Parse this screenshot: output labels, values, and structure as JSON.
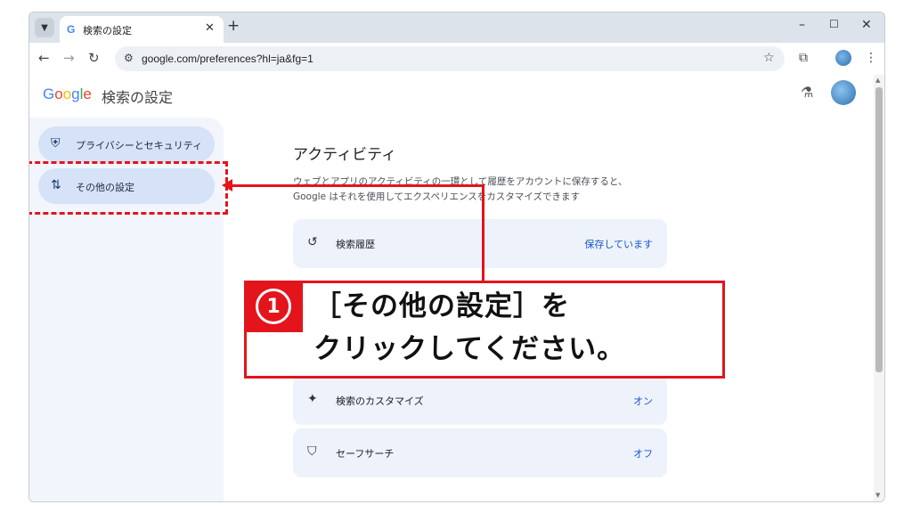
{
  "browser": {
    "tab_title": "検索の設定",
    "tab_favicon": "G",
    "close_tab": "✕",
    "new_tab": "+",
    "url": "google.com/preferences?hl=ja&fg=1",
    "window_minimize": "–",
    "window_maximize": "☐",
    "window_close": "✕"
  },
  "header": {
    "logo": [
      "G",
      "o",
      "o",
      "g",
      "l",
      "e"
    ],
    "logo_colors": [
      "#4285f4",
      "#ea4335",
      "#fbbc05",
      "#4285f4",
      "#34a853",
      "#ea4335"
    ],
    "title": "検索の設定"
  },
  "sidebar": {
    "items": [
      {
        "label": "プライバシーとセキュリティ",
        "icon": "shield-icon"
      },
      {
        "label": "その他の設定",
        "icon": "tune-icon"
      }
    ]
  },
  "main": {
    "section_title": "アクティビティ",
    "description_line1": "ウェブとアプリのアクティビティの一環として履歴をアカウントに保存すると、",
    "description_line2": "Google はそれを使用してエクスペリエンスをカスタマイズできます",
    "cards": [
      {
        "label": "検索履歴",
        "value": "保存しています",
        "icon": "history-icon"
      },
      {
        "label": "検索のカスタマイズ",
        "value": "オン",
        "icon": "sparkle-icon"
      },
      {
        "label": "セーフサーチ",
        "value": "オフ",
        "icon": "safesearch-shield-icon"
      }
    ]
  },
  "annotation": {
    "number": "1",
    "line1": "［その他の設定］を",
    "line2": "クリックしてください。",
    "color": "#e3141c"
  }
}
